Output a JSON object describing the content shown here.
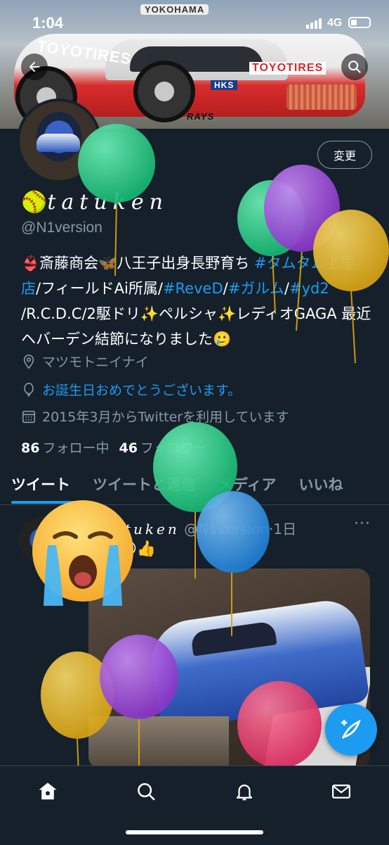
{
  "status_bar": {
    "time": "1:04",
    "network": "4G"
  },
  "header": {
    "banner_text_1": "YOKOHAMA",
    "banner_text_2": "TOYOTIRES",
    "banner_text_3": "TOYOTIRES",
    "banner_text_4": "RAYS",
    "banner_text_5": "HKS"
  },
  "profile": {
    "edit_label": "変更",
    "name_emoji": "🥎",
    "name": "tatuken",
    "handle": "@N1version",
    "bio": {
      "part1": "👙斎藤商会🦋八王子出身長野育ち ",
      "tag1": "#タムタム上里店",
      "part2": "/フィールドAi所属/",
      "tag2": "#ReveD",
      "part3": "/",
      "tag3": "#ガルム",
      "part4": "/",
      "tag4": "#yd2",
      "part5": " /R.C.D.C/2駆ドリ✨ペルシャ✨レディオGAGA 最近ヘバーデン結節になりました🥲"
    },
    "location": "マツモトニイナイ",
    "birthday": "お誕生日おめでとうございます。",
    "joined": "2015年3月からTwitterを利用しています",
    "following_count": "86",
    "following_label": "フォロー中",
    "followers_count": "46",
    "followers_label": "フォロワー"
  },
  "tabs": [
    "ツイート",
    "ツイートと返信",
    "メディア",
    "いいね"
  ],
  "tweet": {
    "name": "tatuken",
    "handle": "@N1version",
    "dot": "·",
    "time": "1日",
    "more": "···",
    "text": "ー😁👍"
  },
  "colors": {
    "accent": "#1d9bf0",
    "background": "#15202b",
    "muted": "#8899a6"
  },
  "icons": [
    "back-arrow-icon",
    "search-icon",
    "location-icon",
    "balloon-icon",
    "calendar-icon",
    "compose-icon",
    "home-icon",
    "explore-icon",
    "notifications-icon",
    "messages-icon"
  ]
}
